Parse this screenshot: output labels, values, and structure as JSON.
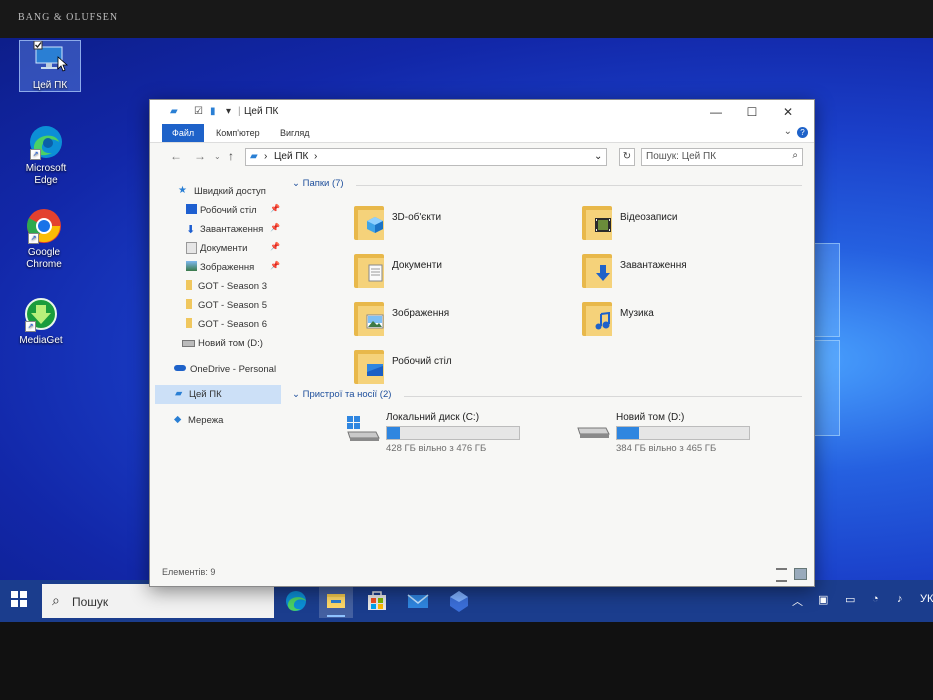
{
  "bezel": {
    "brand": "BANG & OLUFSEN"
  },
  "desktop": {
    "icons": [
      {
        "label": "Цей ПК"
      },
      {
        "label": "Microsoft Edge"
      },
      {
        "label": "Google Chrome"
      },
      {
        "label": "MediaGet"
      }
    ]
  },
  "window": {
    "title": "Цей ПК",
    "ribbon_tabs": [
      "Файл",
      "Комп'ютер",
      "Вигляд"
    ],
    "address_path": "Цей ПК",
    "search_placeholder": "Пошук: Цей ПК",
    "nav_pane": [
      {
        "label": "Швидкий доступ",
        "icon": "star-icon"
      },
      {
        "label": "Робочий стіл",
        "icon": "desktop-folder-icon",
        "pinned": true
      },
      {
        "label": "Завантаження",
        "icon": "download-arrow-icon",
        "pinned": true
      },
      {
        "label": "Документи",
        "icon": "documents-icon",
        "pinned": true
      },
      {
        "label": "Зображення",
        "icon": "pictures-icon",
        "pinned": true
      },
      {
        "label": "GOT - Season 3",
        "icon": "folder-icon"
      },
      {
        "label": "GOT - Season 5",
        "icon": "folder-icon"
      },
      {
        "label": "GOT - Season 6",
        "icon": "folder-icon"
      },
      {
        "label": "Новий том (D:)",
        "icon": "drive-icon"
      },
      {
        "label": "OneDrive - Personal",
        "icon": "cloud-icon"
      },
      {
        "label": "Цей ПК",
        "icon": "computer-icon",
        "selected": true
      },
      {
        "label": "Мережа",
        "icon": "network-icon"
      }
    ],
    "folders_header": "Папки (7)",
    "folders": [
      {
        "label": "3D-об'єкти",
        "icon": "3d-objects-icon"
      },
      {
        "label": "Відеозаписи",
        "icon": "videos-icon"
      },
      {
        "label": "Документи",
        "icon": "documents-icon"
      },
      {
        "label": "Завантаження",
        "icon": "downloads-icon"
      },
      {
        "label": "Зображення",
        "icon": "pictures-icon"
      },
      {
        "label": "Музика",
        "icon": "music-icon"
      },
      {
        "label": "Робочий стіл",
        "icon": "desktop-icon"
      }
    ],
    "devices_header": "Пристрої та носії (2)",
    "drives": [
      {
        "name": "Локальний диск (C:)",
        "free_text": "428 ГБ вільно з 476 ГБ",
        "used_fraction": 0.1
      },
      {
        "name": "Новий том (D:)",
        "free_text": "384 ГБ вільно з 465 ГБ",
        "used_fraction": 0.17
      }
    ],
    "status": "Елементів: 9"
  },
  "taskbar": {
    "search_label": "Пошук",
    "apps": [
      "edge-icon",
      "file-explorer-icon",
      "store-icon",
      "mail-icon",
      "app-icon"
    ],
    "lang": "УК"
  },
  "colors": {
    "accent": "#1e62c9",
    "drive_fill": "#2f86e0",
    "taskbar": "#1b3d8d"
  }
}
